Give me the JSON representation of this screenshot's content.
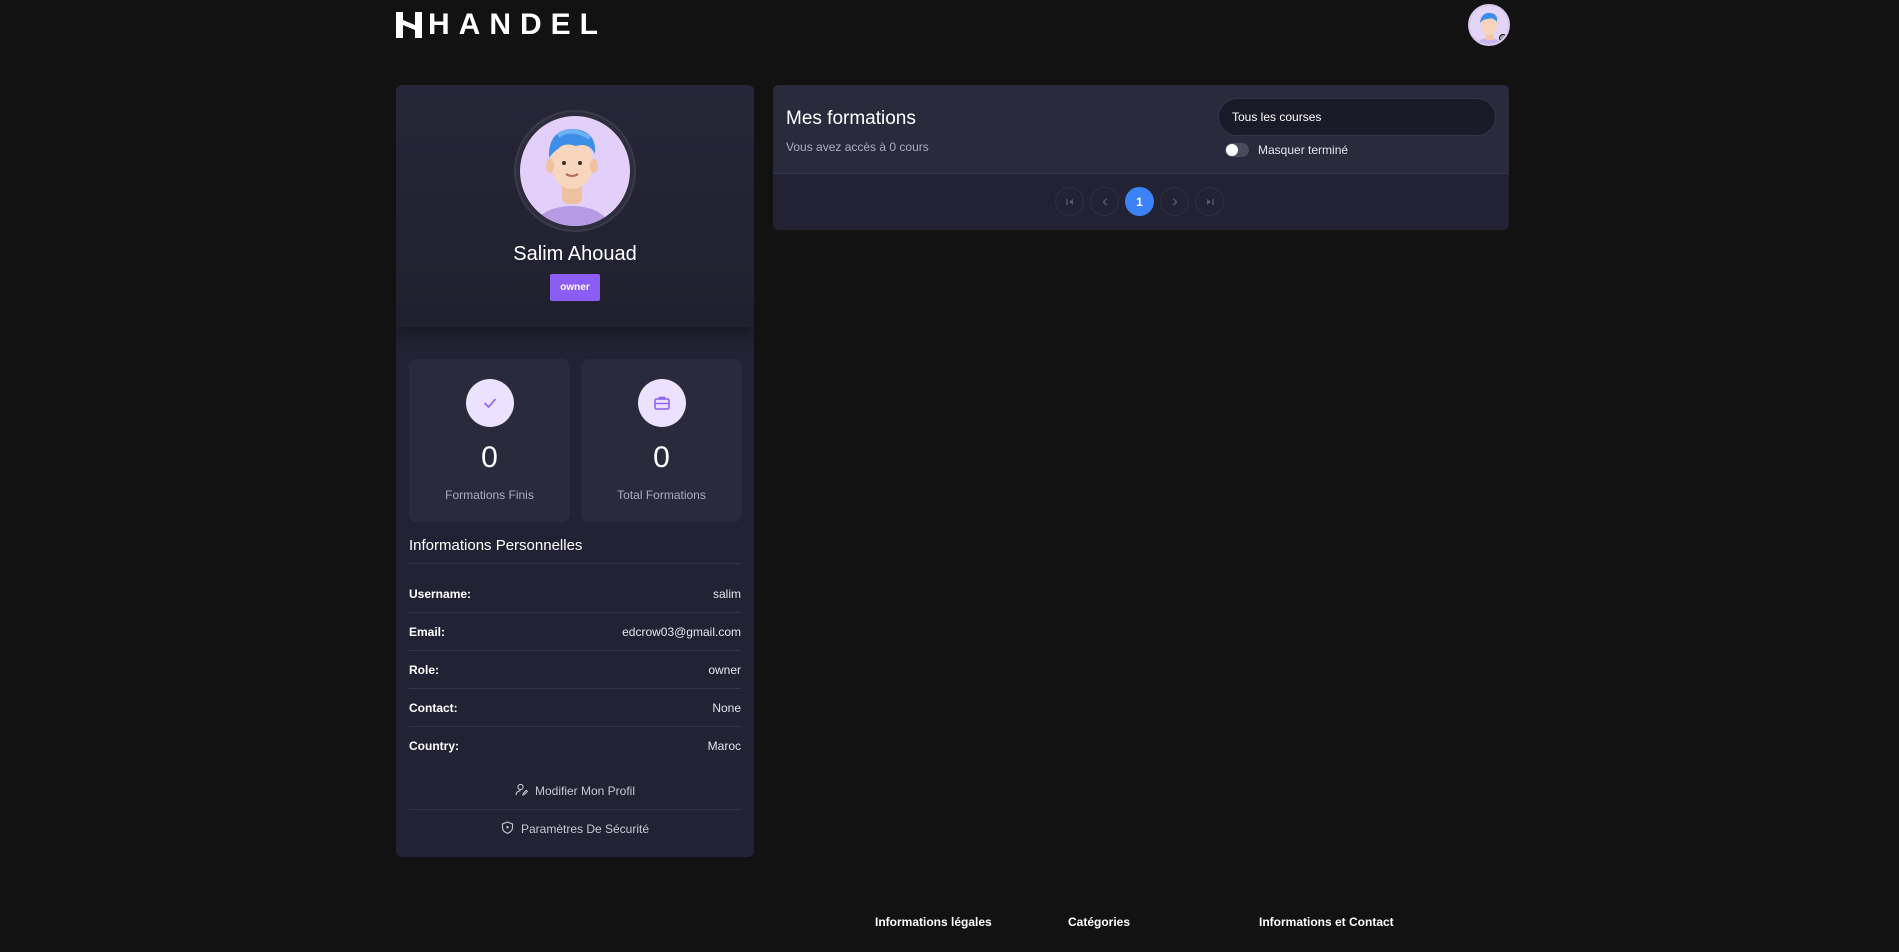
{
  "brand": {
    "name": "HANDEL"
  },
  "profile": {
    "name": "Salim Ahouad",
    "role_badge": "owner"
  },
  "stats": [
    {
      "value": "0",
      "label": "Formations Finis",
      "icon": "check-icon"
    },
    {
      "value": "0",
      "label": "Total Formations",
      "icon": "briefcase-icon"
    }
  ],
  "personal": {
    "title": "Informations Personnelles",
    "rows": [
      {
        "key": "Username:",
        "value": "salim"
      },
      {
        "key": "Email:",
        "value": "edcrow03@gmail.com"
      },
      {
        "key": "Role:",
        "value": "owner"
      },
      {
        "key": "Contact:",
        "value": "None"
      },
      {
        "key": "Country:",
        "value": "Maroc"
      }
    ]
  },
  "actions": {
    "edit_profile": "Modifier Mon Profil",
    "security": "Paramètres De Sécurité"
  },
  "courses": {
    "title": "Mes formations",
    "subtitle": "Vous avez accès à 0 cours",
    "filter_value": "Tous les courses",
    "hide_finished_label": "Masquer terminé",
    "hide_finished": false,
    "current_page": "1"
  },
  "footer": {
    "legal": "Informations légales",
    "categories": "Catégories",
    "contact": "Informations et Contact"
  },
  "colors": {
    "accent": "#8b5cf6",
    "page_active": "#3b82f6",
    "card": "#222234",
    "background": "#121212"
  }
}
